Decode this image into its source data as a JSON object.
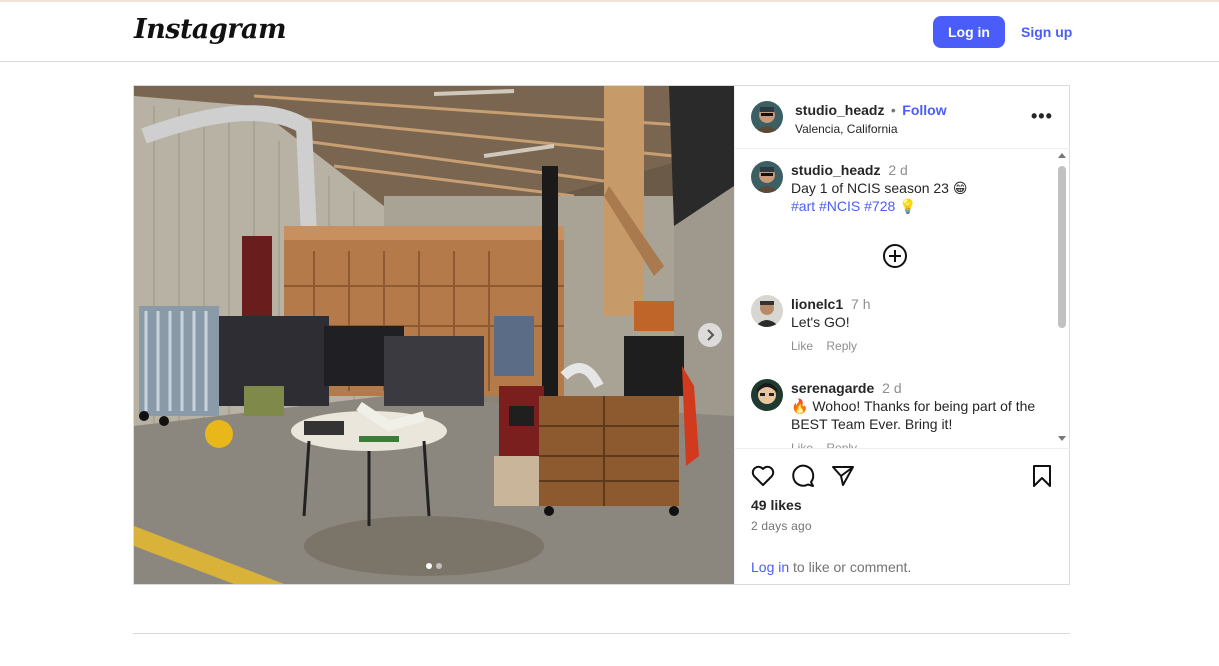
{
  "header": {
    "logo": "Instagram",
    "login_label": "Log in",
    "signup_label": "Sign up",
    "accent": "#4a5df9"
  },
  "post": {
    "author": "studio_headz",
    "separator": "•",
    "follow_label": "Follow",
    "location": "Valencia, California",
    "more_label": "•••",
    "media": {
      "description_icon": "photo",
      "carousel": {
        "count": 2,
        "active": 1
      },
      "next_icon": "chevron-right-icon"
    },
    "comments": [
      {
        "user": "studio_headz",
        "time": "2 d",
        "text": "Day 1 of NCIS season 23 😁",
        "hashtags": [
          "#art",
          "#NCIS",
          "#728"
        ],
        "tail_emoji": "💡"
      },
      {
        "user": "lionelc1",
        "time": "7 h",
        "text": "Let's GO!",
        "like_label": "Like",
        "reply_label": "Reply"
      },
      {
        "user": "serenagarde",
        "time": "2 d",
        "text": "🔥 Wohoo! Thanks for being part of the BEST Team Ever. Bring it!",
        "like_label": "Like",
        "reply_label": "Reply"
      }
    ],
    "likes": "49 likes",
    "posted": "2 days ago",
    "login_link": "Log in",
    "login_suffix": " to like or comment."
  }
}
